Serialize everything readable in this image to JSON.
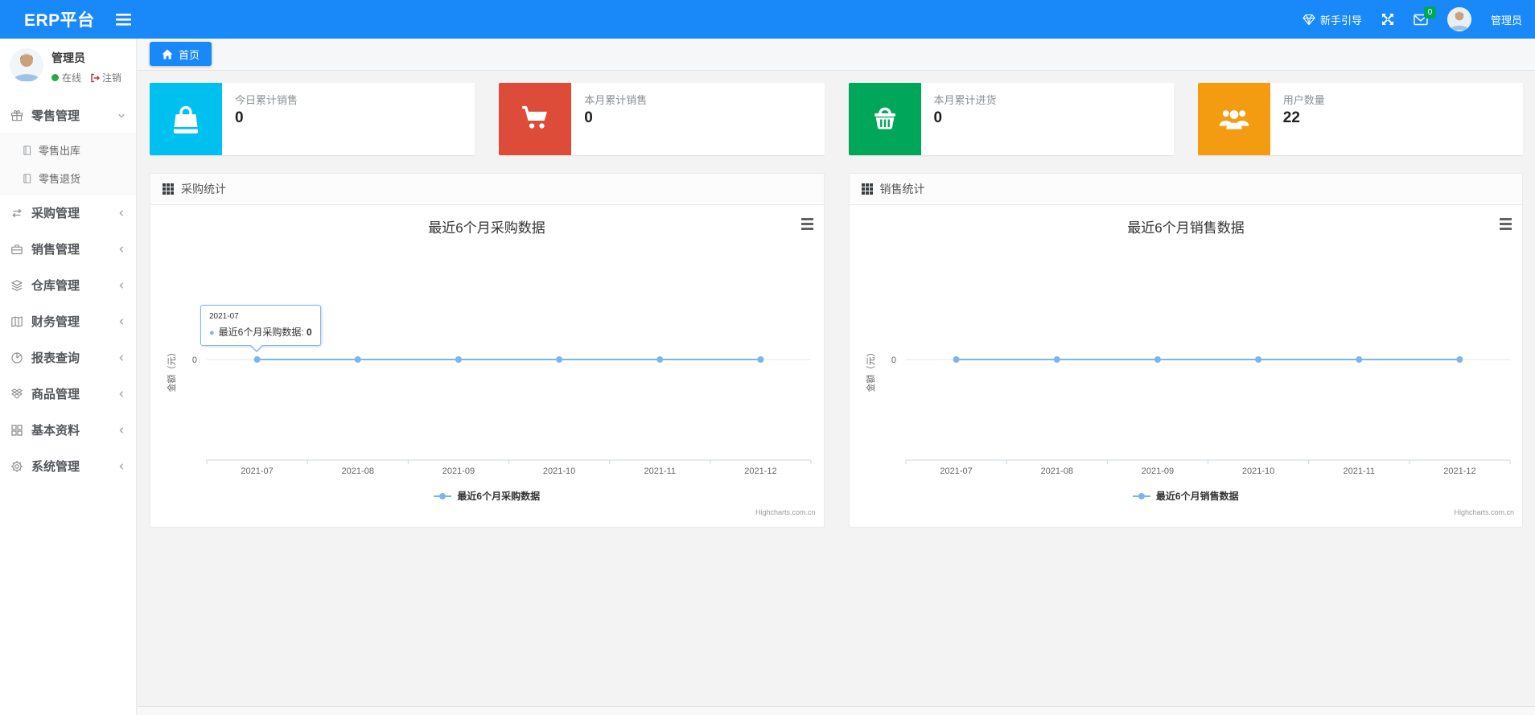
{
  "navbar": {
    "brand": "ERP平台",
    "brand_color": "#1989fa",
    "guide_label": "新手引导",
    "message_badge": "0",
    "badge_color": "#00a65a",
    "username": "管理员"
  },
  "sidebar": {
    "profile": {
      "name": "管理员",
      "status_label": "在线",
      "logout_label": "注销"
    },
    "items": [
      {
        "label": "零售管理",
        "icon": "gift-icon",
        "expanded": true,
        "children": [
          {
            "label": "零售出库",
            "icon": "journal-icon"
          },
          {
            "label": "零售退货",
            "icon": "journal-icon"
          }
        ]
      },
      {
        "label": "采购管理",
        "icon": "exchange-icon"
      },
      {
        "label": "销售管理",
        "icon": "briefcase-icon"
      },
      {
        "label": "仓库管理",
        "icon": "layers-icon"
      },
      {
        "label": "财务管理",
        "icon": "book-icon"
      },
      {
        "label": "报表查询",
        "icon": "pie-chart-icon"
      },
      {
        "label": "商品管理",
        "icon": "dropbox-icon"
      },
      {
        "label": "基本资料",
        "icon": "grid-icon"
      },
      {
        "label": "系统管理",
        "icon": "gear-icon"
      }
    ]
  },
  "tabs": {
    "home_label": "首页"
  },
  "stat_cards": [
    {
      "label": "今日累计销售",
      "value": "0",
      "icon": "shopping-bag-icon",
      "color": "#00c0ef"
    },
    {
      "label": "本月累计销售",
      "value": "0",
      "icon": "cart-icon",
      "color": "#dd4b39"
    },
    {
      "label": "本月累计进货",
      "value": "0",
      "icon": "basket-icon",
      "color": "#00a65a"
    },
    {
      "label": "用户数量",
      "value": "22",
      "icon": "users-icon",
      "color": "#f39c12"
    }
  ],
  "chart_data": [
    {
      "type": "line",
      "panel_title": "采购统计",
      "title": "最近6个月采购数据",
      "categories": [
        "2021-07",
        "2021-08",
        "2021-09",
        "2021-10",
        "2021-11",
        "2021-12"
      ],
      "series": [
        {
          "name": "最近6个月采购数据",
          "values": [
            0,
            0,
            0,
            0,
            0,
            0
          ],
          "color": "#7cb5ec"
        }
      ],
      "ylabel": "金额（元）",
      "yticks": [
        "0"
      ],
      "ylim": [
        0,
        1
      ],
      "grid": true,
      "legend_position": "bottom",
      "credit": "Highcharts.com.cn",
      "tooltip": {
        "visible": true,
        "category": "2021-07",
        "series_label": "最近6个月采购数据:",
        "value": "0"
      }
    },
    {
      "type": "line",
      "panel_title": "销售统计",
      "title": "最近6个月销售数据",
      "categories": [
        "2021-07",
        "2021-08",
        "2021-09",
        "2021-10",
        "2021-11",
        "2021-12"
      ],
      "series": [
        {
          "name": "最近6个月销售数据",
          "values": [
            0,
            0,
            0,
            0,
            0,
            0
          ],
          "color": "#7cb5ec"
        }
      ],
      "ylabel": "金额（元）",
      "yticks": [
        "0"
      ],
      "ylim": [
        0,
        1
      ],
      "grid": true,
      "legend_position": "bottom",
      "credit": "Highcharts.com.cn",
      "tooltip": {
        "visible": false,
        "category": "",
        "series_label": "",
        "value": ""
      }
    }
  ]
}
